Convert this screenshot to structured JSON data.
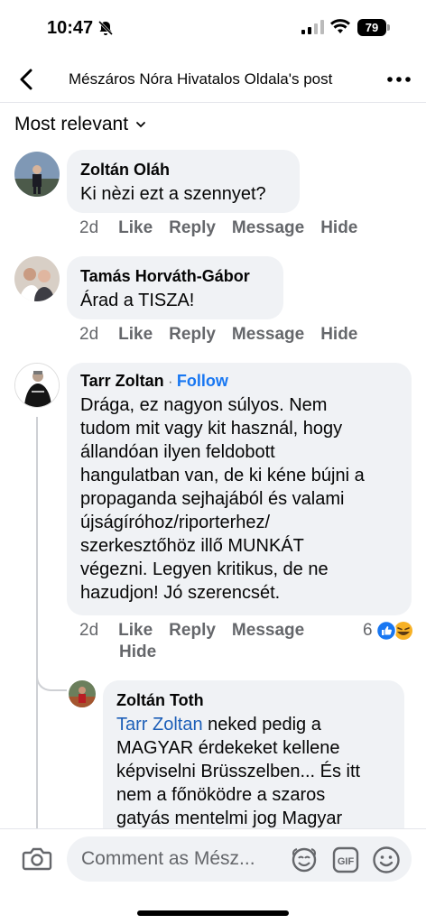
{
  "status": {
    "time": "10:47",
    "battery": "79"
  },
  "header": {
    "title": "Mészáros Nóra Hivatalos Oldala's post"
  },
  "sort": {
    "label": "Most relevant"
  },
  "comments": [
    {
      "author": "Zoltán Oláh",
      "text": "Ki nèzi ezt a szennyet?",
      "age": "2d",
      "actions": [
        "Like",
        "Reply",
        "Message",
        "Hide"
      ]
    },
    {
      "author": "Tamás Horváth-Gábor",
      "text": "Árad a TISZA!",
      "age": "2d",
      "actions": [
        "Like",
        "Reply",
        "Message",
        "Hide"
      ]
    },
    {
      "author": "Tarr Zoltan",
      "follow": "Follow",
      "separator": "·",
      "lines": [
        "Drága, ez nagyon súlyos. Nem",
        "tudom mit vagy kit használ, hogy",
        "állandóan ilyen feldobott",
        "hangulatban van, de ki kéne bújni a",
        "propaganda sejhajából és valami",
        "újságíróhoz/riporterhez/",
        "szerkesztőhöz illő MUNKÁT",
        "végezni. Legyen kritikus, de ne",
        "hazudjon! Jó szerencsét."
      ],
      "age": "2d",
      "actions": [
        "Like",
        "Reply",
        "Message",
        "Hide"
      ],
      "reaction_count": "6"
    },
    {
      "author": "Zoltán Toth",
      "mention": "Tarr Zoltan",
      "lines": [
        " neked pedig a",
        "MAGYAR érdekeket kellene",
        "képviselni Brüsszelben... És itt",
        "nem a főnöködre a szaros",
        "gatyás mentelmi jog Magyar"
      ]
    }
  ],
  "composer": {
    "placeholder": "Comment as Mész..."
  },
  "colors": {
    "accent": "#1877f2",
    "bubble": "#f0f2f5",
    "secondary_text": "#65676b"
  }
}
